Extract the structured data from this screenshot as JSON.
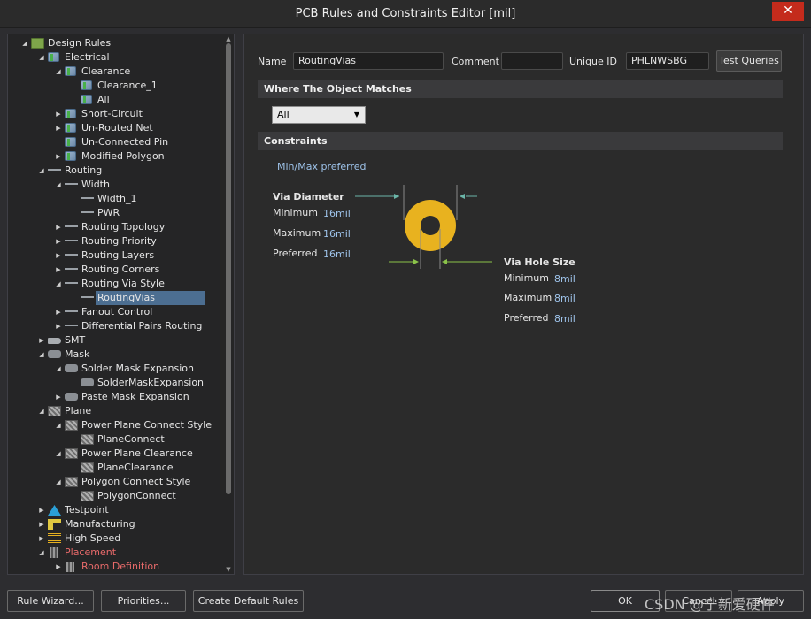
{
  "window": {
    "title": "PCB Rules and Constraints Editor [mil]",
    "close": "✕"
  },
  "tree": [
    {
      "label": "Design Rules",
      "level": 0,
      "arrow": "◢",
      "icon": "folder-icon",
      "cls": "ico-folder"
    },
    {
      "label": "Electrical",
      "level": 1,
      "arrow": "◢",
      "icon": "electrical-rule-icon",
      "cls": "ico-rule ico-elec"
    },
    {
      "label": "Clearance",
      "level": 2,
      "arrow": "◢",
      "icon": "electrical-rule-icon",
      "cls": "ico-rule ico-elec"
    },
    {
      "label": "Clearance_1",
      "level": 3,
      "arrow": "",
      "icon": "electrical-rule-icon",
      "cls": "ico-rule ico-elec"
    },
    {
      "label": "All",
      "level": 3,
      "arrow": "",
      "icon": "electrical-rule-icon",
      "cls": "ico-rule ico-elec"
    },
    {
      "label": "Short-Circuit",
      "level": 2,
      "arrow": "▶",
      "icon": "electrical-rule-icon",
      "cls": "ico-rule ico-elec"
    },
    {
      "label": "Un-Routed Net",
      "level": 2,
      "arrow": "▶",
      "icon": "electrical-rule-icon",
      "cls": "ico-rule ico-elec"
    },
    {
      "label": "Un-Connected Pin",
      "level": 2,
      "arrow": "",
      "icon": "electrical-rule-icon",
      "cls": "ico-rule ico-elec"
    },
    {
      "label": "Modified Polygon",
      "level": 2,
      "arrow": "▶",
      "icon": "electrical-rule-icon",
      "cls": "ico-rule ico-elec"
    },
    {
      "label": "Routing",
      "level": 1,
      "arrow": "◢",
      "icon": "routing-icon",
      "cls": "ico-wire"
    },
    {
      "label": "Width",
      "level": 2,
      "arrow": "◢",
      "icon": "routing-icon",
      "cls": "ico-wire"
    },
    {
      "label": "Width_1",
      "level": 3,
      "arrow": "",
      "icon": "routing-icon",
      "cls": "ico-wire"
    },
    {
      "label": "PWR",
      "level": 3,
      "arrow": "",
      "icon": "routing-icon",
      "cls": "ico-wire"
    },
    {
      "label": "Routing Topology",
      "level": 2,
      "arrow": "▶",
      "icon": "routing-icon",
      "cls": "ico-wire"
    },
    {
      "label": "Routing Priority",
      "level": 2,
      "arrow": "▶",
      "icon": "routing-icon",
      "cls": "ico-wire"
    },
    {
      "label": "Routing Layers",
      "level": 2,
      "arrow": "▶",
      "icon": "routing-icon",
      "cls": "ico-wire"
    },
    {
      "label": "Routing Corners",
      "level": 2,
      "arrow": "▶",
      "icon": "routing-icon",
      "cls": "ico-wire"
    },
    {
      "label": "Routing Via Style",
      "level": 2,
      "arrow": "◢",
      "icon": "routing-icon",
      "cls": "ico-wire"
    },
    {
      "label": "RoutingVias",
      "level": 3,
      "arrow": "",
      "icon": "routing-icon",
      "cls": "ico-wire",
      "selected": true
    },
    {
      "label": "Fanout Control",
      "level": 2,
      "arrow": "▶",
      "icon": "routing-icon",
      "cls": "ico-wire"
    },
    {
      "label": "Differential Pairs Routing",
      "level": 2,
      "arrow": "▶",
      "icon": "routing-icon",
      "cls": "ico-wire"
    },
    {
      "label": "SMT",
      "level": 1,
      "arrow": "▶",
      "icon": "smt-icon",
      "cls": "ico-smt"
    },
    {
      "label": "Mask",
      "level": 1,
      "arrow": "◢",
      "icon": "mask-icon",
      "cls": "ico-pad"
    },
    {
      "label": "Solder Mask Expansion",
      "level": 2,
      "arrow": "◢",
      "icon": "mask-icon",
      "cls": "ico-pad"
    },
    {
      "label": "SolderMaskExpansion",
      "level": 3,
      "arrow": "",
      "icon": "mask-icon",
      "cls": "ico-pad"
    },
    {
      "label": "Paste Mask Expansion",
      "level": 2,
      "arrow": "▶",
      "icon": "mask-icon",
      "cls": "ico-pad"
    },
    {
      "label": "Plane",
      "level": 1,
      "arrow": "◢",
      "icon": "plane-icon",
      "cls": "ico-plane"
    },
    {
      "label": "Power Plane Connect Style",
      "level": 2,
      "arrow": "◢",
      "icon": "plane-icon",
      "cls": "ico-plane"
    },
    {
      "label": "PlaneConnect",
      "level": 3,
      "arrow": "",
      "icon": "plane-icon",
      "cls": "ico-plane"
    },
    {
      "label": "Power Plane Clearance",
      "level": 2,
      "arrow": "◢",
      "icon": "plane-icon",
      "cls": "ico-plane"
    },
    {
      "label": "PlaneClearance",
      "level": 3,
      "arrow": "",
      "icon": "plane-icon",
      "cls": "ico-plane"
    },
    {
      "label": "Polygon Connect Style",
      "level": 2,
      "arrow": "◢",
      "icon": "plane-icon",
      "cls": "ico-plane"
    },
    {
      "label": "PolygonConnect",
      "level": 3,
      "arrow": "",
      "icon": "plane-icon",
      "cls": "ico-plane"
    },
    {
      "label": "Testpoint",
      "level": 1,
      "arrow": "▶",
      "icon": "testpoint-icon",
      "cls": "ico-test"
    },
    {
      "label": "Manufacturing",
      "level": 1,
      "arrow": "▶",
      "icon": "manufacturing-icon",
      "cls": "ico-mfg"
    },
    {
      "label": "High Speed",
      "level": 1,
      "arrow": "▶",
      "icon": "high-speed-icon",
      "cls": "ico-hs"
    },
    {
      "label": "Placement",
      "level": 1,
      "arrow": "◢",
      "icon": "placement-icon",
      "cls": "ico-place",
      "red": true
    },
    {
      "label": "Room Definition",
      "level": 2,
      "arrow": "▶",
      "icon": "placement-icon",
      "cls": "ico-place",
      "red": true
    }
  ],
  "rule": {
    "name_label": "Name",
    "name_value": "RoutingVias",
    "comment_label": "Comment",
    "comment_value": "",
    "uid_label": "Unique ID",
    "uid_value": "PHLNWSBG",
    "test_queries": "Test Queries",
    "where_title": "Where The Object Matches",
    "scope_value": "All",
    "constraints_title": "Constraints",
    "minmax": "Min/Max preferred",
    "via_diameter": {
      "title": "Via Diameter",
      "min_label": "Minimum",
      "min_value": "16mil",
      "max_label": "Maximum",
      "max_value": "16mil",
      "pref_label": "Preferred",
      "pref_value": "16mil"
    },
    "via_hole": {
      "title": "Via Hole Size",
      "min_label": "Minimum",
      "min_value": "8mil",
      "max_label": "Maximum",
      "max_value": "8mil",
      "pref_label": "Preferred",
      "pref_value": "8mil"
    },
    "via_color": "#e8b21f"
  },
  "buttons": {
    "rule_wizard": "Rule Wizard...",
    "priorities": "Priorities...",
    "create_default": "Create Default Rules",
    "ok": "OK",
    "cancel": "Cancel",
    "apply": "Apply"
  },
  "watermark": "CSDN @宁新爱硬件"
}
